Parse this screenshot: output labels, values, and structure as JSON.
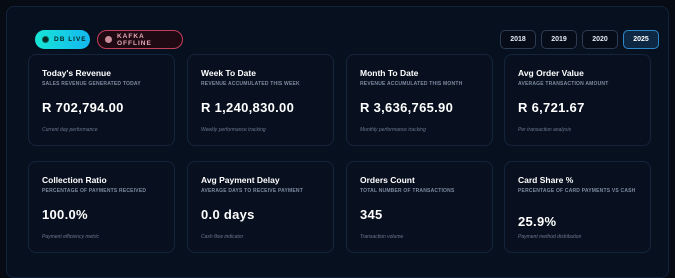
{
  "status": {
    "live_label": "DB LIVE",
    "kafka_label": "KAFKA OFFLINE"
  },
  "years": [
    "2018",
    "2019",
    "2020",
    "2025"
  ],
  "selected_year": "2025",
  "cards": [
    {
      "title": "Today's Revenue",
      "subtitle": "SALES REVENUE GENERATED TODAY",
      "value": "R 702,794.00",
      "note": "Current day performance"
    },
    {
      "title": "Week To Date",
      "subtitle": "REVENUE ACCUMULATED THIS WEEK",
      "value": "R 1,240,830.00",
      "note": "Weekly performance tracking"
    },
    {
      "title": "Month To Date",
      "subtitle": "REVENUE ACCUMULATED THIS MONTH",
      "value": "R 3,636,765.90",
      "note": "Monthly performance tracking"
    },
    {
      "title": "Avg Order Value",
      "subtitle": "AVERAGE TRANSACTION AMOUNT",
      "value": "R 6,721.67",
      "note": "Per transaction analysis"
    },
    {
      "title": "Collection Ratio",
      "subtitle": "PERCENTAGE OF PAYMENTS RECEIVED",
      "value": "100.0%",
      "note": "Payment efficiency metric"
    },
    {
      "title": "Avg Payment Delay",
      "subtitle": "AVERAGE DAYS TO RECEIVE PAYMENT",
      "value": "0.0 days",
      "note": "Cash flow indicator"
    },
    {
      "title": "Orders Count",
      "subtitle": "TOTAL NUMBER OF TRANSACTIONS",
      "value": "345",
      "note": "Transaction volume"
    },
    {
      "title": "Card Share %",
      "subtitle": "PERCENTAGE OF CARD PAYMENTS VS CASH",
      "value": "25.9%",
      "note": "Payment method distribution"
    }
  ],
  "colors": {
    "background": "#060b14",
    "live_accent": "#17e5d6",
    "offline_accent": "#c2415a",
    "active_year_border": "#2d88c9"
  }
}
